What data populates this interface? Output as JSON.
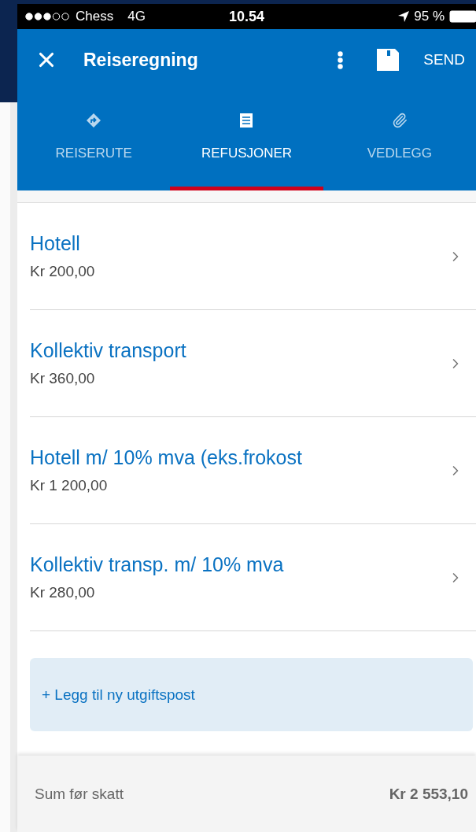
{
  "status_bar": {
    "carrier": "Chess",
    "network": "4G",
    "time": "10.54",
    "battery": "95 %"
  },
  "header": {
    "title": "Reiseregning",
    "action": "SEND"
  },
  "tabs": [
    {
      "label": "REISERUTE",
      "selected": false
    },
    {
      "label": "REFUSJONER",
      "selected": true
    },
    {
      "label": "VEDLEGG",
      "selected": false
    }
  ],
  "items": [
    {
      "title": "Hotell",
      "amount": "Kr 200,00"
    },
    {
      "title": "Kollektiv transport",
      "amount": "Kr 360,00"
    },
    {
      "title": "Hotell m/ 10% mva (eks.frokost",
      "amount": "Kr 1 200,00"
    },
    {
      "title": "Kollektiv transp. m/ 10% mva",
      "amount": "Kr 280,00"
    }
  ],
  "add_button": {
    "label": "+ Legg til ny utgiftspost"
  },
  "footer": {
    "label": "Sum før skatt",
    "total": "Kr 2 553,10"
  }
}
